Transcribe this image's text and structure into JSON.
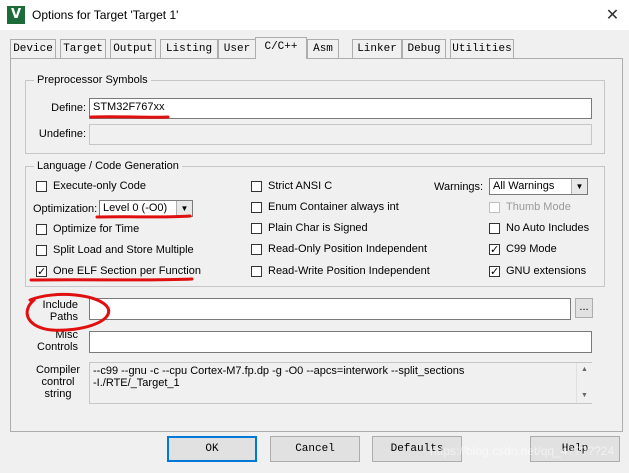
{
  "window": {
    "title": "Options for Target 'Target 1'",
    "app_icon": "V",
    "close_glyph": "✕"
  },
  "tabs": [
    {
      "label": "Device",
      "active": false
    },
    {
      "label": "Target",
      "active": false
    },
    {
      "label": "Output",
      "active": false
    },
    {
      "label": "Listing",
      "active": false
    },
    {
      "label": "User",
      "active": false
    },
    {
      "label": "C/C++",
      "active": true
    },
    {
      "label": "Asm",
      "active": false
    },
    {
      "label": "Linker",
      "active": false
    },
    {
      "label": "Debug",
      "active": false
    },
    {
      "label": "Utilities",
      "active": false
    }
  ],
  "preprocessor": {
    "legend": "Preprocessor Symbols",
    "define_label": "Define:",
    "define_value": "STM32F767xx",
    "undefine_label": "Undefine:",
    "undefine_value": ""
  },
  "language": {
    "legend": "Language / Code Generation",
    "execute_only": {
      "label": "Execute-only Code",
      "checked": false
    },
    "optimization_label": "Optimization:",
    "optimization_value": "Level 0 (-O0)",
    "optimize_time": {
      "label": "Optimize for Time",
      "checked": false
    },
    "split_load": {
      "label": "Split Load and Store Multiple",
      "checked": false
    },
    "one_elf": {
      "label": "One ELF Section per Function",
      "checked": true
    },
    "strict_ansi": {
      "label": "Strict ANSI C",
      "checked": false
    },
    "enum_container": {
      "label": "Enum Container always int",
      "checked": false
    },
    "plain_char": {
      "label": "Plain Char is Signed",
      "checked": false
    },
    "ro_position": {
      "label": "Read-Only Position Independent",
      "checked": false
    },
    "rw_position": {
      "label": "Read-Write Position Independent",
      "checked": false
    },
    "warnings_label": "Warnings:",
    "warnings_value": "All Warnings",
    "thumb_mode": {
      "label": "Thumb Mode",
      "checked": false,
      "disabled": true
    },
    "no_auto_includes": {
      "label": "No Auto Includes",
      "checked": false
    },
    "c99_mode": {
      "label": "C99 Mode",
      "checked": true
    },
    "gnu_ext": {
      "label": "GNU extensions",
      "checked": true
    }
  },
  "include_paths": {
    "label_line1": "Include",
    "label_line2": "Paths",
    "value": "",
    "browse": "..."
  },
  "misc_controls": {
    "label_line1": "Misc",
    "label_line2": "Controls",
    "value": ""
  },
  "compiler_string": {
    "label_line1": "Compiler",
    "label_line2": "control",
    "label_line3": "string",
    "line1": "--c99 --gnu -c --cpu Cortex-M7.fp.dp -g -O0 --apcs=interwork --split_sections",
    "line2": "-I./RTE/_Target_1"
  },
  "buttons": {
    "ok": "OK",
    "cancel": "Cancel",
    "defaults": "Defaults",
    "help": "Help"
  },
  "watermark": "https://blog.csdn.net/qq_4?????24",
  "colors": {
    "annotation_red": "#e01010",
    "active_border": "#0078d7"
  }
}
